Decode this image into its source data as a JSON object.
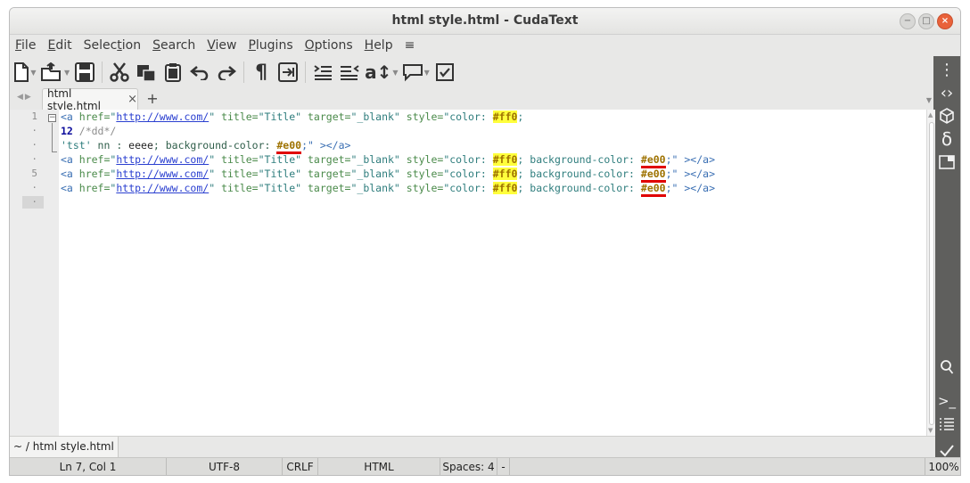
{
  "window": {
    "title": "html style.html - CudaText"
  },
  "menu": [
    {
      "u": "F",
      "rest": "ile"
    },
    {
      "u": "E",
      "rest": "dit"
    },
    {
      "pre": "Selec",
      "u": "t",
      "rest": "ion"
    },
    {
      "u": "S",
      "rest": "earch"
    },
    {
      "u": "V",
      "rest": "iew"
    },
    {
      "u": "P",
      "rest": "lugins"
    },
    {
      "u": "O",
      "rest": "ptions"
    },
    {
      "u": "H",
      "rest": "elp"
    },
    {
      "rest": "≡"
    }
  ],
  "tabs": {
    "active_label": "html style.html",
    "close_glyph": "×",
    "add_glyph": "+"
  },
  "gutter": {
    "lines": [
      "1",
      "·",
      "·",
      "·",
      "5",
      "·",
      "·"
    ]
  },
  "code": {
    "l1": {
      "open": "<a ",
      "href_attr": "href=",
      "q1": "\"",
      "url": "http://www.com/",
      "q2": "\"",
      "title_attr": " title=",
      "title_val": "\"Title\"",
      "target_attr": " target=",
      "target_val": "\"_blank\"",
      "style_attr": " style=",
      "style_open": "\"color: ",
      "color1": "#ff0",
      "semi": ";"
    },
    "l2": {
      "num": "12",
      "comment": " /*dd*/"
    },
    "l3": {
      "str": "'tst'",
      "mid": " nn : ",
      "word": "eeee",
      "bg": "; background-color: ",
      "color2": "#e00",
      "end": ";\" ></a>"
    },
    "l4": {
      "open": "<a ",
      "href_attr": "href=",
      "q1": "\"",
      "url": "http://www.com/",
      "q2": "\"",
      "title_attr": " title=",
      "title_val": "\"Title\"",
      "target_attr": " target=",
      "target_val": "\"_blank\"",
      "style_attr": " style=",
      "style_open": "\"color: ",
      "color1": "#ff0",
      "bg": "; background-color: ",
      "color2": "#e00",
      "end": ";\" ></a>"
    },
    "l5": {
      "open": "<a ",
      "href_attr": "href=",
      "q1": "\"",
      "url": "http://www.com/",
      "q2": "\"",
      "title_attr": " title=",
      "title_val": "\"Title\"",
      "target_attr": " target=",
      "target_val": "\"_blank\"",
      "style_attr": " style=",
      "style_open": "\"color: ",
      "color1": "#ff0",
      "bg": "; background-color: ",
      "color2": "#e00",
      "end": ";\" ></a>"
    },
    "l6": {
      "open": "<a ",
      "href_attr": "href=",
      "q1": "\"",
      "url": "http://www.com/",
      "q2": "\"",
      "title_attr": " title=",
      "title_val": "\"Title\"",
      "target_attr": " target=",
      "target_val": "\"_blank\"",
      "style_attr": " style=",
      "style_open": "\"color: ",
      "color1": "#ff0",
      "bg": "; background-color: ",
      "color2": "#e00",
      "end": ";\" ></a>"
    }
  },
  "pathbar": {
    "path": "~ / html style.html"
  },
  "status": {
    "position": "Ln 7, Col 1",
    "encoding": "UTF-8",
    "line_ending": "CRLF",
    "lexer": "HTML",
    "indent": "Spaces: 4",
    "extra": "-",
    "zoom": "100%"
  },
  "colors": {
    "accent_close": "#e9623a",
    "sidebar": "#5f5f5d",
    "swatch_yellow": "#ffff3c",
    "swatch_red_underline": "#e00000"
  },
  "icons": {
    "toolbar": [
      "new-file-icon",
      "open-file-icon",
      "save-icon",
      "cut-icon",
      "copy-icon",
      "paste-icon",
      "undo-icon",
      "redo-icon",
      "pilcrow-icon",
      "indent-mark-icon",
      "indent-icon",
      "unindent-icon",
      "change-case-icon",
      "comment-icon",
      "checkbox-icon"
    ],
    "sidebar": [
      "more-vert-icon",
      "code-tree-icon",
      "package-icon",
      "delta-icon",
      "panel-icon",
      "search-icon",
      "console-icon",
      "list-icon",
      "check-icon"
    ]
  }
}
